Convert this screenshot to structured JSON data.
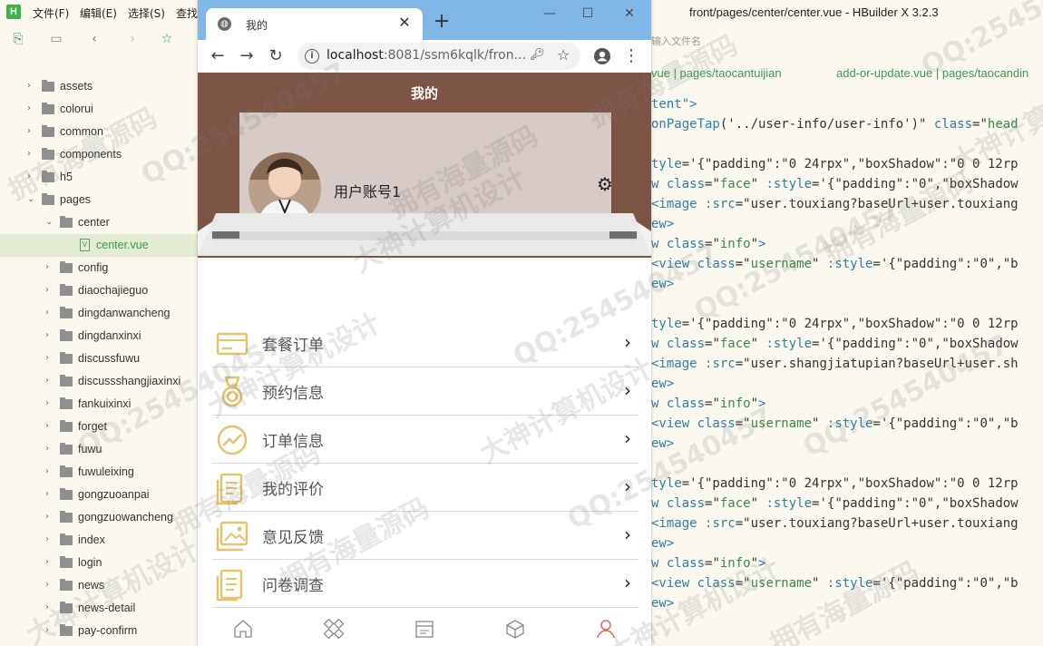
{
  "ide": {
    "menus": [
      "文件(F)",
      "编辑(E)",
      "选择(S)",
      "查找"
    ],
    "window_title": "front/pages/center/center.vue - HBuilder X 3.2.3",
    "search_hint": "输入文件名",
    "file_tabs": [
      "vue | pages/taocantuijian",
      "add-or-update.vue | pages/taocandin"
    ],
    "tree": [
      {
        "label": "assets",
        "type": "folder",
        "level": 1,
        "expanded": false
      },
      {
        "label": "colorui",
        "type": "folder",
        "level": 1,
        "expanded": false
      },
      {
        "label": "common",
        "type": "folder",
        "level": 1,
        "expanded": false
      },
      {
        "label": "components",
        "type": "folder",
        "level": 1,
        "expanded": false
      },
      {
        "label": "h5",
        "type": "folder",
        "level": 1,
        "expanded": false
      },
      {
        "label": "pages",
        "type": "folder",
        "level": 1,
        "expanded": true
      },
      {
        "label": "center",
        "type": "folder",
        "level": 2,
        "expanded": true
      },
      {
        "label": "center.vue",
        "type": "file",
        "level": 3,
        "selected": true
      },
      {
        "label": "config",
        "type": "folder",
        "level": 2,
        "expanded": false
      },
      {
        "label": "diaochajieguo",
        "type": "folder",
        "level": 2,
        "expanded": false
      },
      {
        "label": "dingdanwancheng",
        "type": "folder",
        "level": 2,
        "expanded": false
      },
      {
        "label": "dingdanxinxi",
        "type": "folder",
        "level": 2,
        "expanded": false
      },
      {
        "label": "discussfuwu",
        "type": "folder",
        "level": 2,
        "expanded": false
      },
      {
        "label": "discussshangjiaxinxi",
        "type": "folder",
        "level": 2,
        "expanded": false
      },
      {
        "label": "fankuixinxi",
        "type": "folder",
        "level": 2,
        "expanded": false
      },
      {
        "label": "forget",
        "type": "folder",
        "level": 2,
        "expanded": false
      },
      {
        "label": "fuwu",
        "type": "folder",
        "level": 2,
        "expanded": false
      },
      {
        "label": "fuwuleixing",
        "type": "folder",
        "level": 2,
        "expanded": false
      },
      {
        "label": "gongzuoanpai",
        "type": "folder",
        "level": 2,
        "expanded": false
      },
      {
        "label": "gongzuowancheng",
        "type": "folder",
        "level": 2,
        "expanded": false
      },
      {
        "label": "index",
        "type": "folder",
        "level": 2,
        "expanded": false
      },
      {
        "label": "login",
        "type": "folder",
        "level": 2,
        "expanded": false
      },
      {
        "label": "news",
        "type": "folder",
        "level": 2,
        "expanded": false
      },
      {
        "label": "news-detail",
        "type": "folder",
        "level": 2,
        "expanded": false
      },
      {
        "label": "pay-confirm",
        "type": "folder",
        "level": 2,
        "expanded": false
      }
    ],
    "code_lines": [
      [
        [
          "c-attr",
          "tent\""
        ],
        [
          "c-tag",
          ">"
        ]
      ],
      [
        [
          "c-attr",
          "onPageTap"
        ],
        [
          "c-txt",
          "('../user-info/user-info')\" "
        ],
        [
          "c-attr",
          "class"
        ],
        [
          "c-txt",
          "=\""
        ],
        [
          "c-str",
          "head"
        ]
      ],
      [],
      [
        [
          "c-attr",
          "tyle"
        ],
        [
          "c-txt",
          "='{\"padding\":\"0 24rpx\",\"boxShadow\":\"0 0 12rp"
        ]
      ],
      [
        [
          "c-tag",
          "w "
        ],
        [
          "c-attr",
          "class"
        ],
        [
          "c-txt",
          "=\""
        ],
        [
          "c-str",
          "face"
        ],
        [
          "c-txt",
          "\" "
        ],
        [
          "c-attr",
          ":style"
        ],
        [
          "c-txt",
          "='{\"padding\":\"0\",\"boxShadow"
        ]
      ],
      [
        [
          "c-tag",
          "<image "
        ],
        [
          "c-attr",
          ":src"
        ],
        [
          "c-txt",
          "=\"user.touxiang?baseUrl+user.touxiang"
        ]
      ],
      [
        [
          "c-tag",
          "ew>"
        ]
      ],
      [
        [
          "c-tag",
          "w "
        ],
        [
          "c-attr",
          "class"
        ],
        [
          "c-txt",
          "=\""
        ],
        [
          "c-str",
          "info"
        ],
        [
          "c-txt",
          "\""
        ],
        [
          "c-tag",
          ">"
        ]
      ],
      [
        [
          "c-tag",
          "<view "
        ],
        [
          "c-attr",
          "class"
        ],
        [
          "c-txt",
          "=\""
        ],
        [
          "c-str",
          "username"
        ],
        [
          "c-txt",
          "\" "
        ],
        [
          "c-attr",
          ":style"
        ],
        [
          "c-txt",
          "='{\"padding\":\"0\",\"b"
        ]
      ],
      [
        [
          "c-tag",
          "ew>"
        ]
      ],
      [],
      [
        [
          "c-attr",
          "tyle"
        ],
        [
          "c-txt",
          "='{\"padding\":\"0 24rpx\",\"boxShadow\":\"0 0 12rp"
        ]
      ],
      [
        [
          "c-tag",
          "w "
        ],
        [
          "c-attr",
          "class"
        ],
        [
          "c-txt",
          "=\""
        ],
        [
          "c-str",
          "face"
        ],
        [
          "c-txt",
          "\" "
        ],
        [
          "c-attr",
          ":style"
        ],
        [
          "c-txt",
          "='{\"padding\":\"0\",\"boxShadow"
        ]
      ],
      [
        [
          "c-tag",
          "<image "
        ],
        [
          "c-attr",
          ":src"
        ],
        [
          "c-txt",
          "=\"user.shangjiatupian?baseUrl+user.sh"
        ]
      ],
      [
        [
          "c-tag",
          "ew>"
        ]
      ],
      [
        [
          "c-tag",
          "w "
        ],
        [
          "c-attr",
          "class"
        ],
        [
          "c-txt",
          "=\""
        ],
        [
          "c-str",
          "info"
        ],
        [
          "c-txt",
          "\""
        ],
        [
          "c-tag",
          ">"
        ]
      ],
      [
        [
          "c-tag",
          "<view "
        ],
        [
          "c-attr",
          "class"
        ],
        [
          "c-txt",
          "=\""
        ],
        [
          "c-str",
          "username"
        ],
        [
          "c-txt",
          "\" "
        ],
        [
          "c-attr",
          ":style"
        ],
        [
          "c-txt",
          "='{\"padding\":\"0\",\"b"
        ]
      ],
      [
        [
          "c-tag",
          "ew>"
        ]
      ],
      [],
      [
        [
          "c-attr",
          "tyle"
        ],
        [
          "c-txt",
          "='{\"padding\":\"0 24rpx\",\"boxShadow\":\"0 0 12rp"
        ]
      ],
      [
        [
          "c-tag",
          "w "
        ],
        [
          "c-attr",
          "class"
        ],
        [
          "c-txt",
          "=\""
        ],
        [
          "c-str",
          "face"
        ],
        [
          "c-txt",
          "\" "
        ],
        [
          "c-attr",
          ":style"
        ],
        [
          "c-txt",
          "='{\"padding\":\"0\",\"boxShadow"
        ]
      ],
      [
        [
          "c-tag",
          "<image "
        ],
        [
          "c-attr",
          ":src"
        ],
        [
          "c-txt",
          "=\"user.touxiang?baseUrl+user.touxiang"
        ]
      ],
      [
        [
          "c-tag",
          "ew>"
        ]
      ],
      [
        [
          "c-tag",
          "w "
        ],
        [
          "c-attr",
          "class"
        ],
        [
          "c-txt",
          "=\""
        ],
        [
          "c-str",
          "info"
        ],
        [
          "c-txt",
          "\""
        ],
        [
          "c-tag",
          ">"
        ]
      ],
      [
        [
          "c-tag",
          "<view "
        ],
        [
          "c-attr",
          "class"
        ],
        [
          "c-txt",
          "=\""
        ],
        [
          "c-str",
          "username"
        ],
        [
          "c-txt",
          "\" "
        ],
        [
          "c-attr",
          ":style"
        ],
        [
          "c-txt",
          "='{\"padding\":\"0\",\"b"
        ]
      ],
      [
        [
          "c-tag",
          "ew>"
        ]
      ]
    ]
  },
  "browser": {
    "tab_title": "我的",
    "tab_close": "✕",
    "new_tab": "+",
    "url_host": "localhost",
    "url_rest": ":8081/ssm6kqlk/fron...",
    "window_controls": [
      "—",
      "☐",
      "✕"
    ]
  },
  "app": {
    "nav_title": "我的",
    "username": "用户账号1",
    "accent_color": "#e6c36a",
    "header_color": "#7b5445",
    "menu": [
      {
        "label": "套餐订单",
        "icon": "card-icon"
      },
      {
        "label": "预约信息",
        "icon": "medal-icon"
      },
      {
        "label": "订单信息",
        "icon": "chart-circle-icon"
      },
      {
        "label": "我的评价",
        "icon": "document-icon"
      },
      {
        "label": "意见反馈",
        "icon": "image-icon"
      },
      {
        "label": "问卷调查",
        "icon": "document-icon"
      }
    ],
    "tabbar": [
      {
        "icon": "home-icon",
        "active": false
      },
      {
        "icon": "grid-icon",
        "active": false
      },
      {
        "icon": "calendar-icon",
        "active": false
      },
      {
        "icon": "cube-icon",
        "active": false
      },
      {
        "icon": "user-icon",
        "active": true
      }
    ]
  },
  "watermarks": [
    "拥有海量源码",
    "QQ:254540457",
    "大神计算机设计"
  ]
}
